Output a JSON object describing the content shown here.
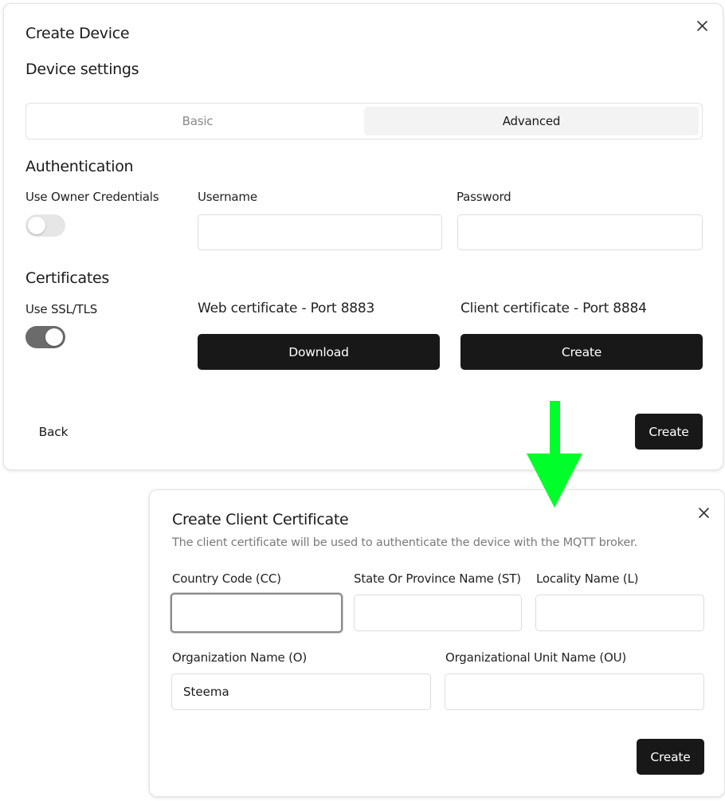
{
  "modal1": {
    "title": "Create Device",
    "subtitle": "Device settings",
    "tabs": [
      {
        "label": "Basic",
        "active": false
      },
      {
        "label": "Advanced",
        "active": true
      }
    ],
    "authentication": {
      "heading": "Authentication",
      "owner_credentials_label": "Use Owner Credentials",
      "owner_credentials_enabled": false,
      "username_label": "Username",
      "username_value": "",
      "password_label": "Password",
      "password_value": ""
    },
    "certificates": {
      "heading": "Certificates",
      "ssl_label": "Use SSL/TLS",
      "ssl_enabled": true,
      "web_cert_label": "Web certificate - Port 8883",
      "download_label": "Download",
      "client_cert_label": "Client certificate - Port 8884",
      "create_cert_label": "Create"
    },
    "back_label": "Back",
    "create_label": "Create"
  },
  "modal2": {
    "title": "Create Client Certificate",
    "description": "The client certificate will be used to authenticate the device with the MQTT broker.",
    "fields": {
      "country_code": {
        "label": "Country Code (CC)",
        "value": ""
      },
      "state": {
        "label": "State Or Province Name (ST)",
        "value": ""
      },
      "locality": {
        "label": "Locality Name (L)",
        "value": ""
      },
      "organization": {
        "label": "Organization Name (O)",
        "value": "Steema"
      },
      "org_unit": {
        "label": "Organizational Unit Name (OU)",
        "value": ""
      }
    },
    "create_label": "Create"
  },
  "colors": {
    "dark_button": "#181818",
    "arrow": "#00ff2a",
    "toggle_on": "#6b6b6b",
    "toggle_off": "#e6e6e6"
  },
  "icons": {
    "close": "close-icon",
    "arrow": "arrow-down-icon"
  }
}
